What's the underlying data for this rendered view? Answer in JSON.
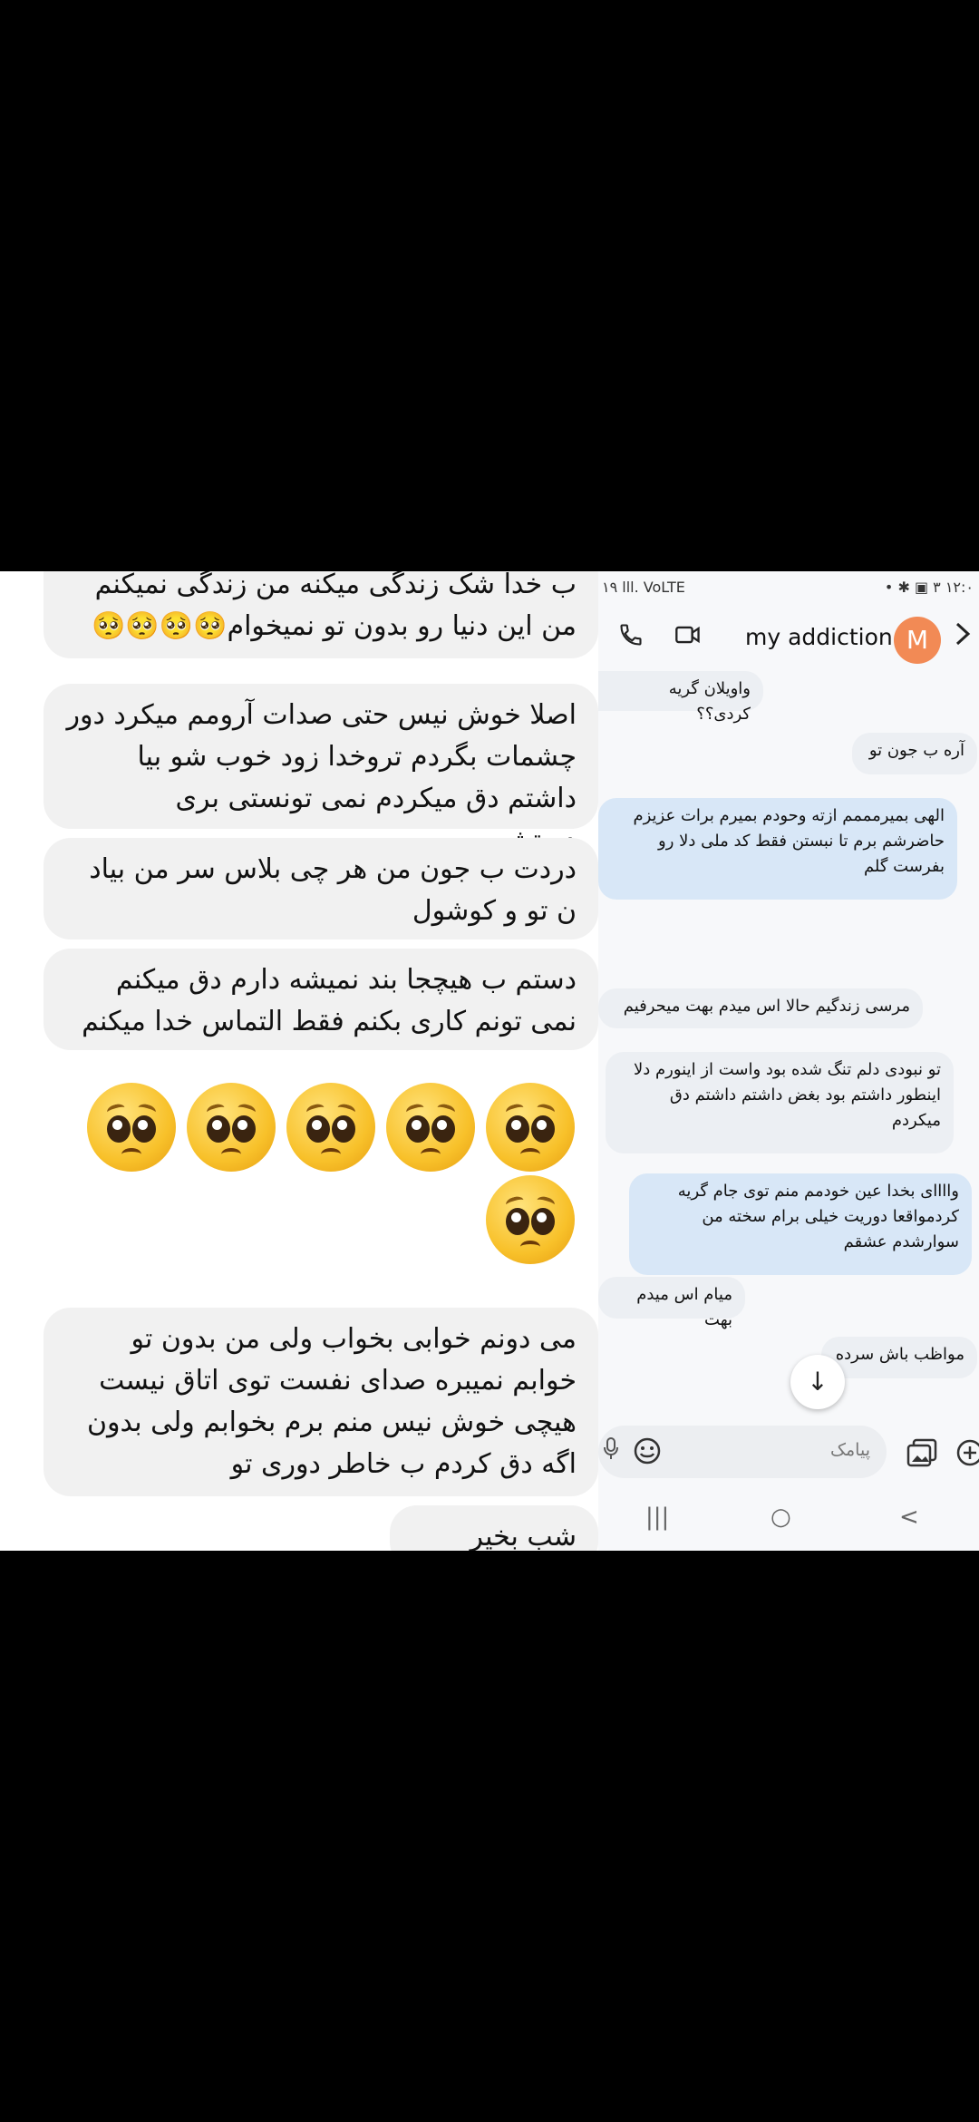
{
  "left_messages": [
    "ب خدا شک زندگی میکنه من زندگی نمیکنم من این دنیا رو بدون تو نمیخوام🥺🥺🥺🥺",
    "اصلا خوش نیس حتی صدات آرومم میکرد دور چشمات بگردم تروخدا زود خوب شو بیا داشتم دق میکردم نمی تونستی بری دستشویی",
    "دردت ب جون من هر چی بلاس سر من بیاد ن تو و کوشول",
    "دستم ب هیچجا بند نمیشه دارم دق میکنم نمی تونم کاری بکنم فقط التماس خدا میکنم",
    "می دونم خوابی بخواب ولی من بدون تو خوابم نمیبره صدای نفست توی اتاق نیست هیچی خوش نیس منم برم بخوابم ولی بدون اگه دق کردم ب خاطر دوری تو",
    "شب بخیر عمرم"
  ],
  "emoji_row": {
    "name": "pleading-face",
    "count": 6
  },
  "right_panel": {
    "status_left": "۱۹ lll. VoLTE",
    "status_right": "• ✱ ▣ ۳ ۱۲:۰",
    "contact_name": "my addiction",
    "avatar_letter": "M",
    "icons": {
      "call": "phone-icon",
      "video": "video-icon",
      "more": "chevron-right-icon"
    },
    "messages": [
      {
        "dir": "in",
        "text": "واویلان گریه کردی؟؟"
      },
      {
        "dir": "out",
        "text": "آره ب جون تو"
      },
      {
        "dir": "in",
        "text": "الهی بمیرمممم ازته وحودم بمیرم برات  عزیزم حاضرشم برم تا نبستن فقط کد ملی دلا رو بفرست گلم"
      },
      {
        "dir": "in",
        "text": "مرسی زندگیم حالا اس میدم بهت میحرفیم"
      },
      {
        "dir": "out",
        "text": "تو نبودی دلم تنگ شده بود واست از اینورم دلا اینطور داشتم بود بغض داشتم داشتم دق میکردم"
      },
      {
        "dir": "in",
        "text": "واااای بخدا عین خودمم منم توی جام گریه کردمواقعا دوریت خیلی برام سخته من سوارشدم عشقم"
      },
      {
        "dir": "in",
        "text": "میام اس میدم بهت"
      },
      {
        "dir": "out",
        "text": "مواظب باش سرده"
      }
    ],
    "input_placeholder": "پیامک",
    "nav": {
      "recent": "|||",
      "home": "○",
      "back": "<"
    }
  }
}
